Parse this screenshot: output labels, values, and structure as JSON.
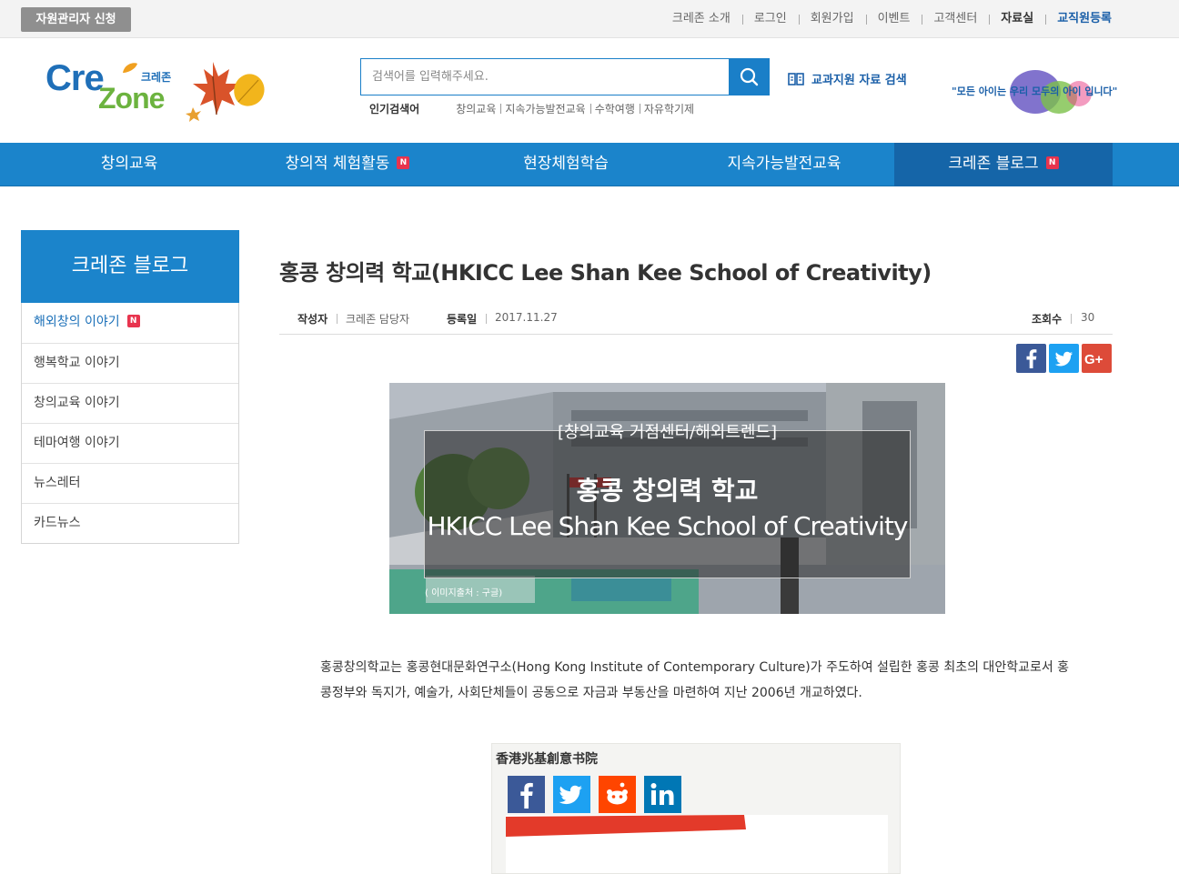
{
  "topbar": {
    "admin_button": "자원관리자 신청",
    "links": [
      "크레존 소개",
      "로그인",
      "회원가입",
      "이벤트",
      "고객센터",
      "자료실",
      "교직원등록"
    ]
  },
  "header": {
    "logo": {
      "cre": "Cre",
      "zone": "Zone",
      "kr": "크레존"
    },
    "search": {
      "placeholder": "검색어를 입력해주세요."
    },
    "popular_label": "인기검색어",
    "popular_terms": [
      "창의교육",
      "지속가능발전교육",
      "수학여행",
      "자유학기제"
    ],
    "resource_search": "교과지원 자료 검색",
    "slogan": "\"모든 아이는 우리 모두의 아이 입니다\""
  },
  "mainnav": {
    "items": [
      {
        "label": "창의교육"
      },
      {
        "label": "창의적 체험활동",
        "badge": "N"
      },
      {
        "label": "현장체험학습"
      },
      {
        "label": "지속가능발전교육"
      },
      {
        "label": "크레존 블로그",
        "badge": "N"
      }
    ]
  },
  "sidebar": {
    "title": "크레존 블로그",
    "items": [
      {
        "label": "해외창의 이야기",
        "badge": "N"
      },
      {
        "label": "행복학교 이야기"
      },
      {
        "label": "창의교육 이야기"
      },
      {
        "label": "테마여행 이야기"
      },
      {
        "label": "뉴스레터"
      },
      {
        "label": "카드뉴스"
      }
    ]
  },
  "article": {
    "title": "홍콩 창의력 학교(HKICC Lee Shan Kee School of Creativity)",
    "author_label": "작성자",
    "author": "크레존 담당자",
    "date_label": "등록일",
    "date": "2017.11.27",
    "views_label": "조회수",
    "views": "30",
    "hero": {
      "subtitle": "[창의교육 거점센터/해외트렌드]",
      "title_kr": "홍콩 창의력 학교",
      "title_en": "HKICC Lee Shan Kee School of Creativity",
      "caption": "( 이미지출처 : 구글)"
    },
    "body": "홍콩창의학교는 홍콩현대문화연구소(Hong Kong Institute of Contemporary Culture)가 주도하여 설립한 홍콩 최초의 대안학교로서 홍콩정부와 독지가, 예술가, 사회단체들이 공동으로 자금과 부동산을 마련하여 지난 2006년 개교하였다.",
    "embed_title": "香港兆基創意书院"
  },
  "colors": {
    "primary_blue": "#1b84cb",
    "nav_active": "#1565a8",
    "badge_red": "#e8344e",
    "facebook": "#3b5998",
    "twitter": "#1da1f2",
    "googleplus": "#dd4b39"
  }
}
